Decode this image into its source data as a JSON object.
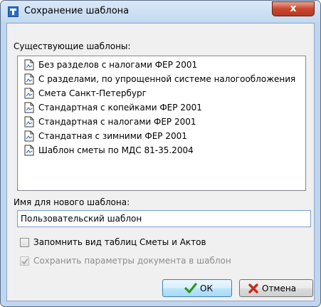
{
  "window": {
    "title": "Сохранение шаблона",
    "close_symbol": "x"
  },
  "existing": {
    "label": "Существующие шаблоны:",
    "items": [
      {
        "label": "Без разделов с налогами ФЕР 2001",
        "icon": "document-icon"
      },
      {
        "label": "С разделами, по упрощенной системе налогообложения",
        "icon": "document-icon"
      },
      {
        "label": "Смета Санкт-Петербург",
        "icon": "document-icon"
      },
      {
        "label": "Стандартная с копейками ФЕР 2001",
        "icon": "document-icon"
      },
      {
        "label": "Стандартная с налогами ФЕР 2001",
        "icon": "document-icon"
      },
      {
        "label": "Стандатная с зимними ФЕР 2001",
        "icon": "document-icon"
      },
      {
        "label": "Шаблон сметы по МДС 81-35.2004",
        "icon": "document-icon"
      }
    ]
  },
  "new_name": {
    "label": "Имя для нового шаблона:",
    "value": "Пользовательский шаблон"
  },
  "options": {
    "remember_view": {
      "label": "Запомнить вид таблиц Сметы и Актов",
      "checked": false
    },
    "save_params": {
      "label": "Сохранить параметры документа в шаблон",
      "checked": true,
      "disabled": true
    }
  },
  "buttons": {
    "ok": "ОК",
    "cancel": "Отмена"
  },
  "colors": {
    "ok_check": "#2a9a1c",
    "cancel_x": "#c0301f",
    "frame": "#bfd6ee",
    "close_button": "#c7472f"
  }
}
